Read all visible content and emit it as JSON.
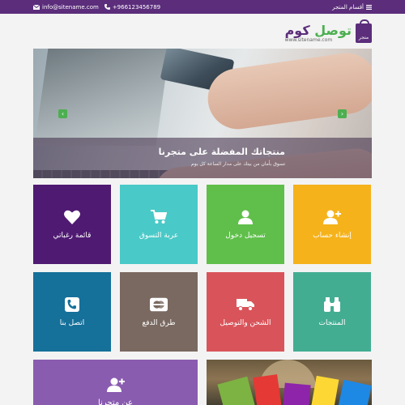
{
  "topbar": {
    "email": "info@sitename.com",
    "phone": "+966123456789",
    "menu_label": "أقسام المتجر"
  },
  "logo": {
    "bag_label": "متجر",
    "name_word1": "توصل",
    "name_word2": "كوم",
    "site": "www.sitename.com"
  },
  "slider": {
    "title_part1": "منتجاتك المفضلة على ",
    "title_part2": "متجرنا",
    "subtitle": "تسوق بأمان من بيتك على مدار الساعة كل يوم"
  },
  "tiles": [
    {
      "label": "إنشاء حساب",
      "color": "#f5b21b",
      "icon": "user-plus-icon"
    },
    {
      "label": "تسجيل دخول",
      "color": "#5fbf4a",
      "icon": "user-icon"
    },
    {
      "label": "عربة التسوق",
      "color": "#49c9c7",
      "icon": "cart-icon"
    },
    {
      "label": "قائمة رغباتي",
      "color": "#4f1a72",
      "icon": "heart-icon"
    },
    {
      "label": "المنتجات",
      "color": "#43ad92",
      "icon": "binoculars-icon"
    },
    {
      "label": "الشحن والتوصيل",
      "color": "#d9545a",
      "icon": "truck-icon"
    },
    {
      "label": "طرق الدفع",
      "color": "#7a6961",
      "icon": "credit-card-icon"
    },
    {
      "label": "اتصل بنا",
      "color": "#15709a",
      "icon": "phone-icon"
    }
  ],
  "about": {
    "label": "عن متجرنا",
    "color": "#8a5cb0",
    "icon": "user-plus-icon"
  }
}
